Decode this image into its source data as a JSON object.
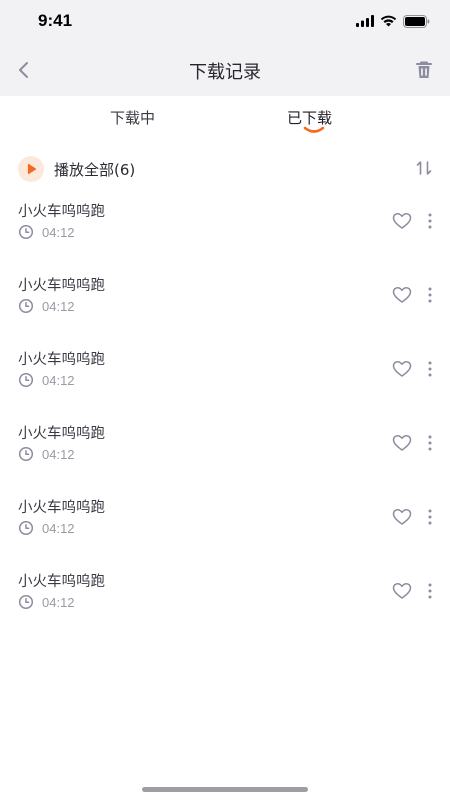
{
  "status": {
    "time": "9:41"
  },
  "nav": {
    "title": "下载记录"
  },
  "tabs": [
    {
      "label": "下载中",
      "active": false
    },
    {
      "label": "已下载",
      "active": true
    }
  ],
  "play_all": {
    "label": "播放全部(6)"
  },
  "items": [
    {
      "title": "小火车呜呜跑",
      "duration": "04:12"
    },
    {
      "title": "小火车呜呜跑",
      "duration": "04:12"
    },
    {
      "title": "小火车呜呜跑",
      "duration": "04:12"
    },
    {
      "title": "小火车呜呜跑",
      "duration": "04:12"
    },
    {
      "title": "小火车呜呜跑",
      "duration": "04:12"
    },
    {
      "title": "小火车呜呜跑",
      "duration": "04:12"
    }
  ],
  "colors": {
    "accent": "#f26b21",
    "header_bg": "#f2f2f4",
    "icon_gray": "#8c8ca0"
  },
  "icons": [
    "chevron-left-icon",
    "trash-icon",
    "play-icon",
    "sort-icon",
    "clock-icon",
    "heart-icon",
    "more-vertical-icon"
  ]
}
